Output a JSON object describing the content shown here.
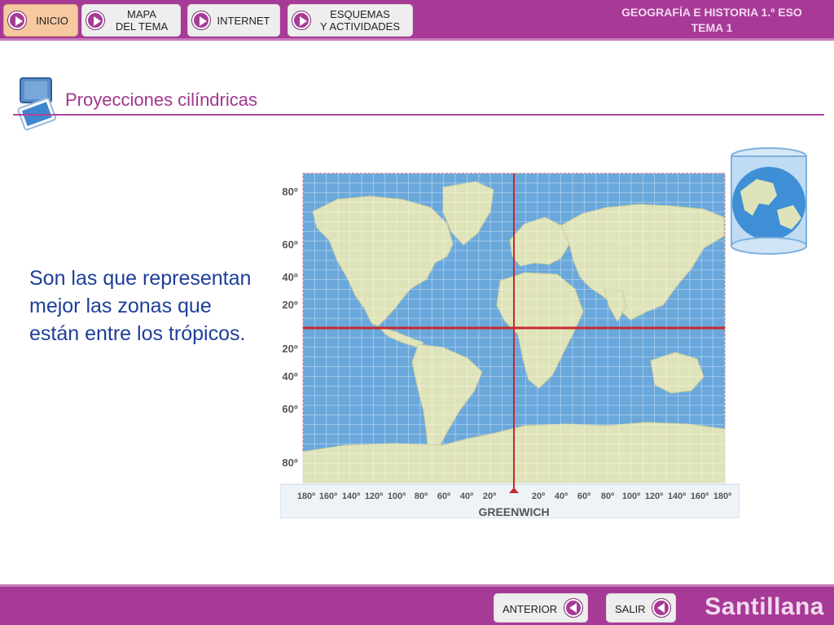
{
  "header": {
    "buttons": [
      {
        "label": "INICIO"
      },
      {
        "label_line1": "MAPA",
        "label_line2": "DEL TEMA"
      },
      {
        "label": "INTERNET"
      },
      {
        "label_line1": "ESQUEMAS",
        "label_line2": "Y ACTIVIDADES"
      }
    ],
    "course_line1": "GEOGRAFÍA E HISTORIA 1.º ESO",
    "course_line2": "TEMA 1"
  },
  "section_title": "Proyecciones cilíndricas",
  "description": "Son las que representan mejor las zonas que están entre los trópicos.",
  "map": {
    "lat_labels": [
      "80º",
      "60º",
      "40º",
      "20º",
      "20º",
      "40º",
      "60º",
      "80º"
    ],
    "lon_labels": [
      "180º",
      "160º",
      "140º",
      "120º",
      "100º",
      "80º",
      "60º",
      "40º",
      "20º",
      "20º",
      "40º",
      "60º",
      "80º",
      "100º",
      "120º",
      "140º",
      "160º",
      "180º"
    ],
    "meridian_label": "GREENWICH"
  },
  "footer": {
    "prev_label": "ANTERIOR",
    "exit_label": "SALIR",
    "brand": "Santillana"
  },
  "colors": {
    "accent": "#a73a96",
    "ocean": "#6aa8dc",
    "land": "#dfe3b9",
    "reference_lines": "#c8282e",
    "text_blue": "#1e3f9a"
  }
}
